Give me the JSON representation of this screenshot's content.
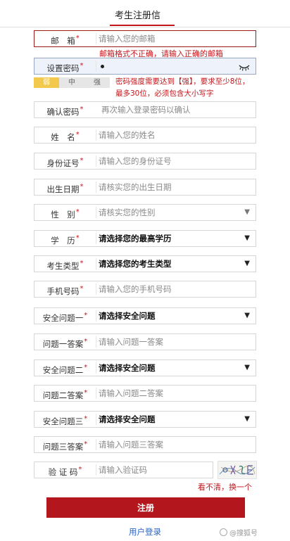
{
  "tab": {
    "label": "考生注册信"
  },
  "email": {
    "label": "邮　箱",
    "placeholder": "请输入您的邮箱",
    "error": "邮箱格式不正确，请输入正确的邮箱"
  },
  "password": {
    "label": "设置密码",
    "strength": [
      "弱",
      "中",
      "强"
    ],
    "hint": "密码强度需要达到【强】，要求至少8位，最多30位，必须包含大小写字"
  },
  "confirm_password": {
    "label": "确认密码",
    "placeholder": "再次输入登录密码以确认"
  },
  "name": {
    "label": "姓　名",
    "placeholder": "请输入您的姓名"
  },
  "id_number": {
    "label": "身份证号",
    "placeholder": "请输入您的身份证号"
  },
  "birth_date": {
    "label": "出生日期",
    "placeholder": "请核实您的出生日期"
  },
  "gender": {
    "label": "性　别",
    "value": "请核实您的性别"
  },
  "education": {
    "label": "学　历",
    "value": "请选择您的最高学历"
  },
  "candidate_type": {
    "label": "考生类型",
    "value": "请选择您的考生类型"
  },
  "phone": {
    "label": "手机号码",
    "placeholder": "请输入您的手机号码"
  },
  "security_q1": {
    "label": "安全问题一",
    "value": "请选择安全问题"
  },
  "answer1": {
    "label": "问题一答案",
    "placeholder": "请输入问题一答案"
  },
  "security_q2": {
    "label": "安全问题二",
    "value": "请选择安全问题"
  },
  "answer2": {
    "label": "问题二答案",
    "placeholder": "请输入问题二答案"
  },
  "security_q3": {
    "label": "安全问题三",
    "value": "请选择安全问题"
  },
  "answer3": {
    "label": "问题三答案",
    "placeholder": "请输入问题三答案"
  },
  "captcha": {
    "label": "验 证 码",
    "placeholder": "请输入验证码",
    "refresh": "看不清，换一个"
  },
  "submit_label": "注册",
  "login_link": "用户登录",
  "watermark": "@搜狐号",
  "required_mark": "*",
  "icons": {
    "select": "caret-down-icon",
    "password_toggle": "eye-closed-icon"
  },
  "colors": {
    "accent": "#b3161c",
    "error_text": "#c3161c",
    "link": "#2b64c4",
    "strength_weak": "#f2c94c"
  }
}
